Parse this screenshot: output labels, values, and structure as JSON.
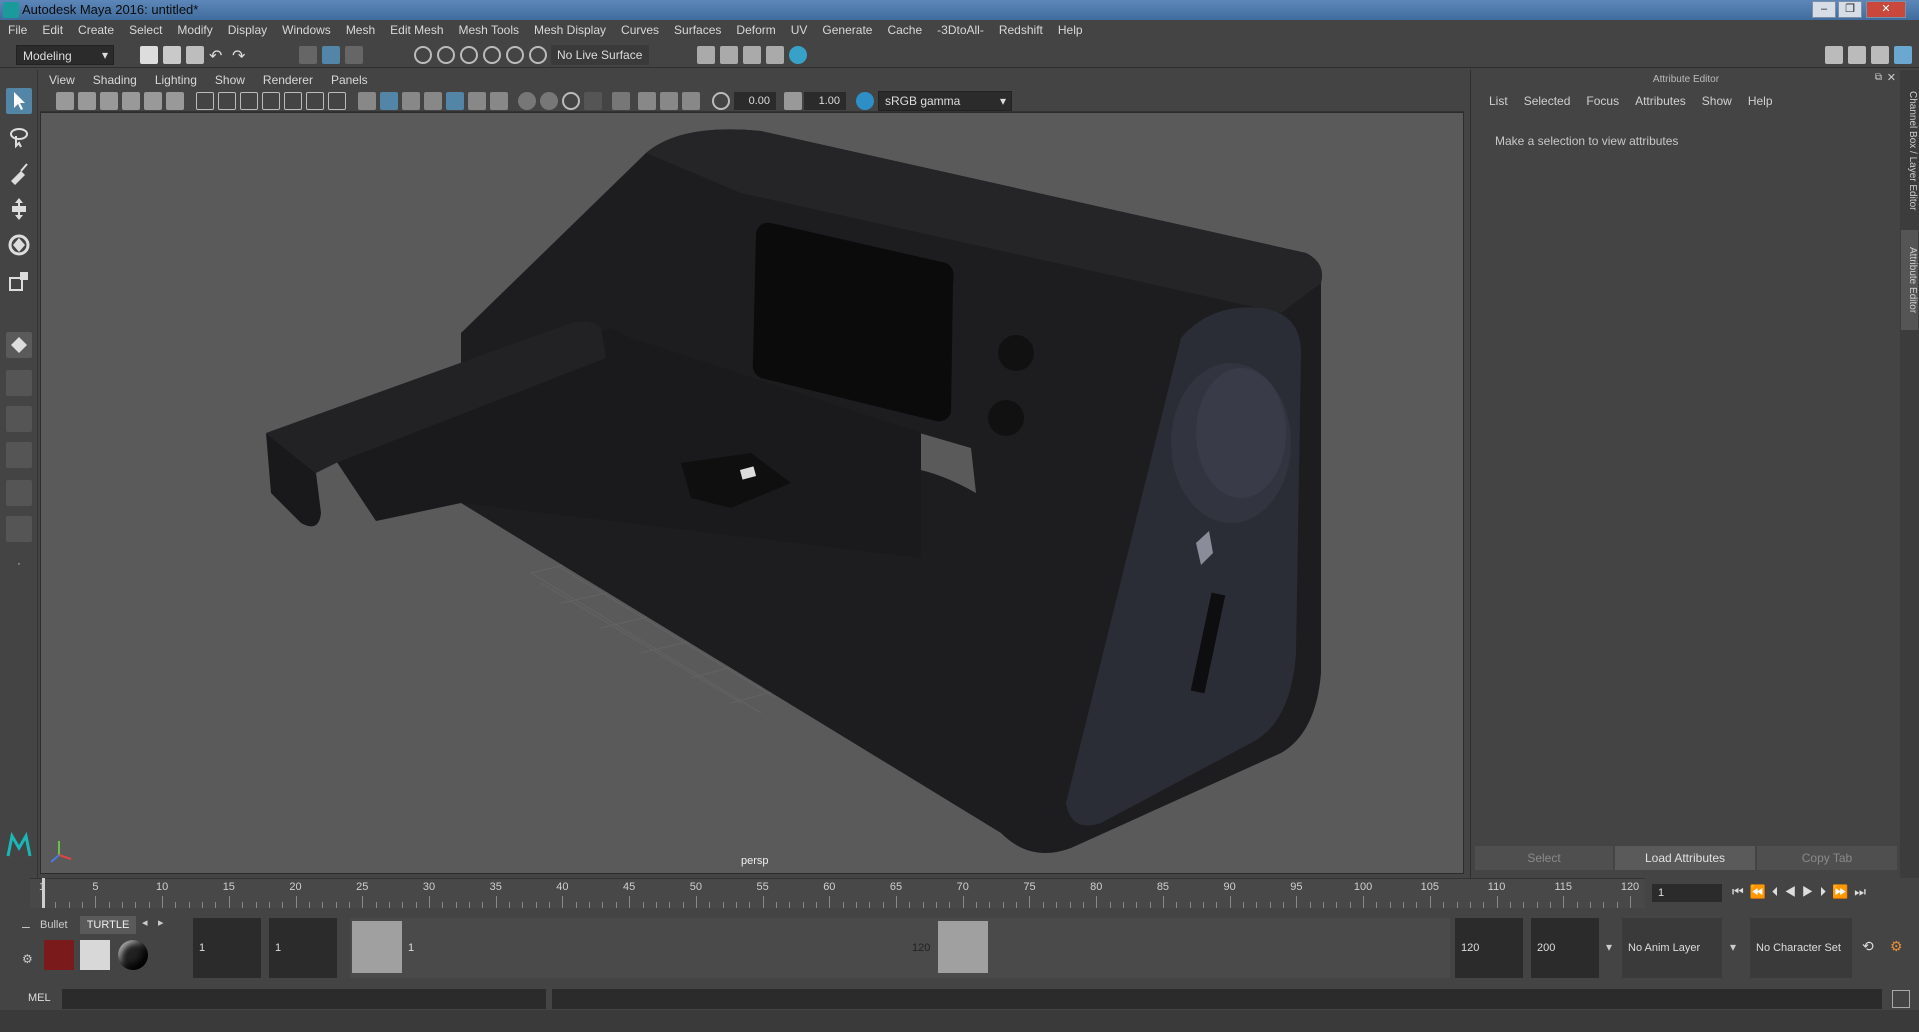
{
  "window": {
    "title": "Autodesk Maya 2016: untitled*"
  },
  "menubar": [
    "File",
    "Edit",
    "Create",
    "Select",
    "Modify",
    "Display",
    "Windows",
    "Mesh",
    "Edit Mesh",
    "Mesh Tools",
    "Mesh Display",
    "Curves",
    "Surfaces",
    "Deform",
    "UV",
    "Generate",
    "Cache",
    "-3DtoAll-",
    "Redshift",
    "Help"
  ],
  "statusline": {
    "menuset": "Modeling",
    "live_surface": "No Live Surface"
  },
  "viewport": {
    "menu": [
      "View",
      "Shading",
      "Lighting",
      "Show",
      "Renderer",
      "Panels"
    ],
    "exposure": "0.00",
    "gamma": "1.00",
    "color_space": "sRGB gamma",
    "camera": "persp"
  },
  "attribute_editor": {
    "header": "Attribute Editor",
    "menu": [
      "List",
      "Selected",
      "Focus",
      "Attributes",
      "Show",
      "Help"
    ],
    "message": "Make a selection to view attributes",
    "buttons": {
      "select": "Select",
      "load": "Load Attributes",
      "copy": "Copy Tab"
    }
  },
  "side_tabs": {
    "channel_box": "Channel Box / Layer Editor",
    "attr_editor": "Attribute Editor"
  },
  "timeline": {
    "ticks": [
      "1",
      "5",
      "10",
      "15",
      "20",
      "25",
      "30",
      "35",
      "40",
      "45",
      "50",
      "55",
      "60",
      "65",
      "70",
      "75",
      "80",
      "85",
      "90",
      "95",
      "100",
      "105",
      "110",
      "115",
      "120"
    ],
    "current_frame": "1"
  },
  "range": {
    "shelf_tabs": [
      "Bullet",
      "TURTLE"
    ],
    "start_field": "1",
    "playback_start": "1",
    "range_start_label": "1",
    "range_end_label": "120",
    "playback_end": "120",
    "end_field": "200",
    "anim_layer": "No Anim Layer",
    "char_set": "No Character Set"
  },
  "cmdline": {
    "label": "MEL"
  },
  "colors": {
    "accent": "#5285a6",
    "viewport_bg": "#5a5a5a",
    "panel_bg": "#444444"
  }
}
